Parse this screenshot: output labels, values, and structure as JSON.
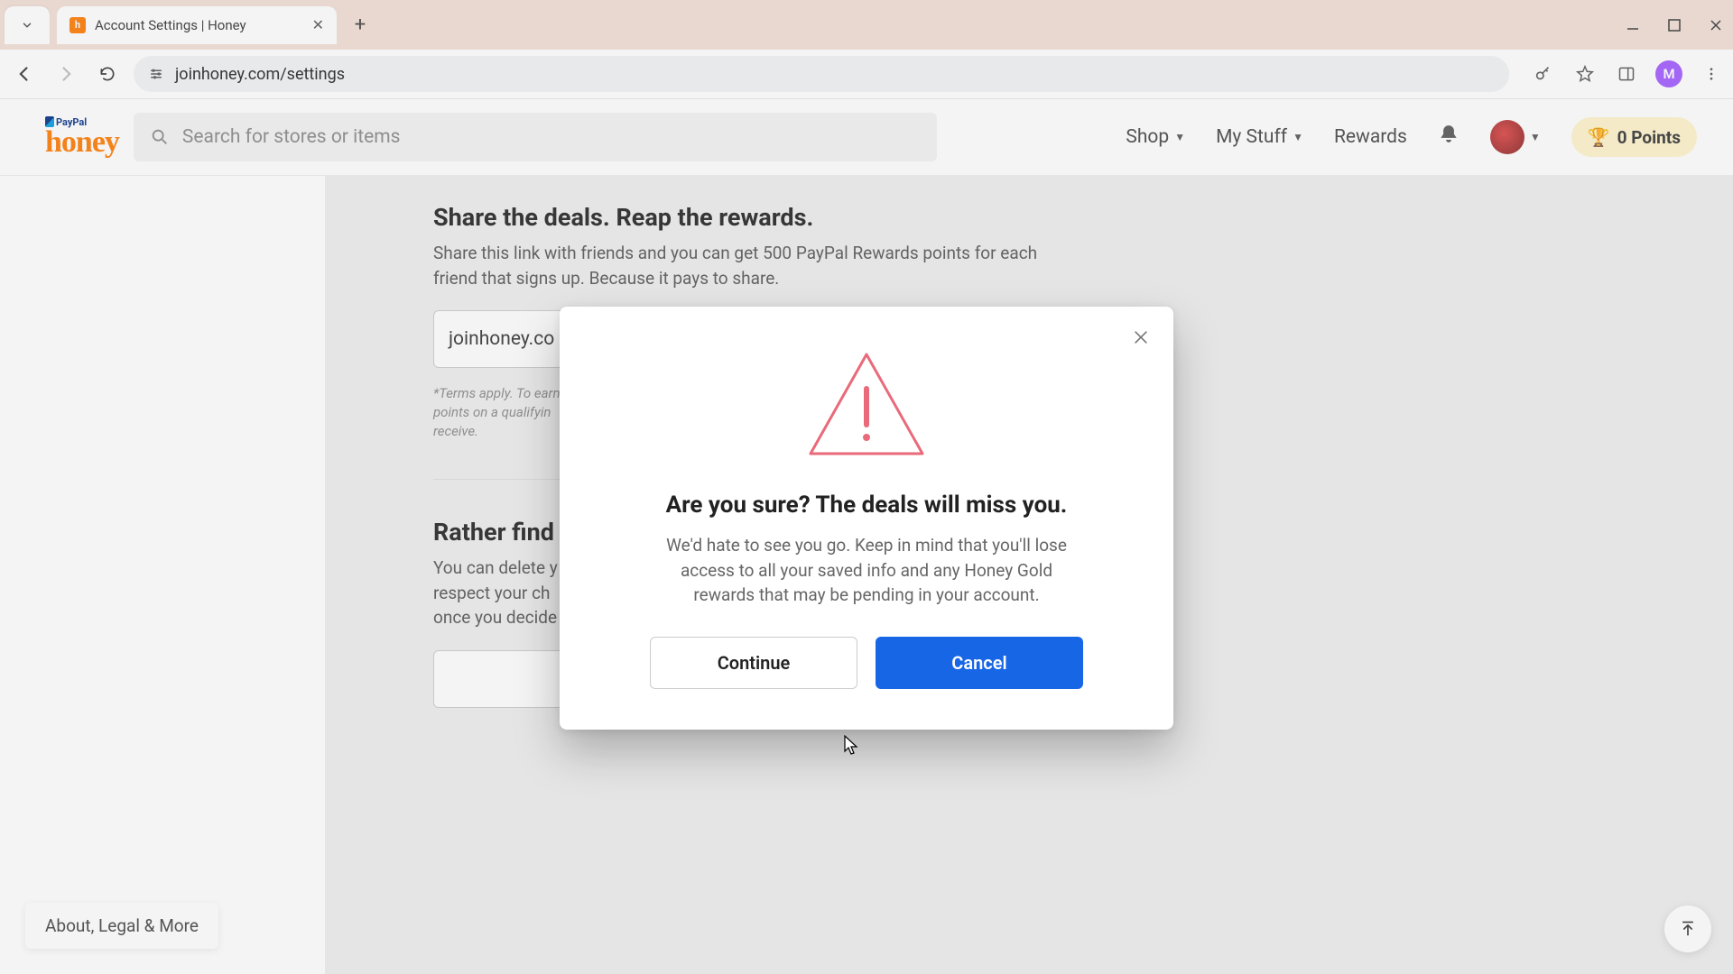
{
  "browser": {
    "tab_title": "Account Settings | Honey",
    "url": "joinhoney.com/settings",
    "profile_initial": "M"
  },
  "header": {
    "paypal_label": "PayPal",
    "logo_text": "honey",
    "search_placeholder": "Search for stores or items",
    "nav": {
      "shop": "Shop",
      "mystuff": "My Stuff",
      "rewards": "Rewards"
    },
    "points_label": "0 Points"
  },
  "page": {
    "share": {
      "title": "Share the deals. Reap the rewards.",
      "desc": "Share this link with friends and you can get 500 PayPal Rewards points for each friend that signs up. Because it pays to share.",
      "referral_value": "joinhoney.co",
      "fine1": "*Terms apply. To earn",
      "fine2": "points on a qualifyin",
      "fine3": "receive."
    },
    "delete": {
      "title": "Rather find",
      "d1": "You can delete y",
      "d2": "respect your ch",
      "d3": "once you decide"
    },
    "footer_link": "About, Legal & More"
  },
  "modal": {
    "title": "Are you sure? The deals will miss you.",
    "desc": "We'd hate to see you go. Keep in mind that you'll lose access to all your saved info and any Honey Gold rewards that may be pending in your account.",
    "continue": "Continue",
    "cancel": "Cancel"
  }
}
